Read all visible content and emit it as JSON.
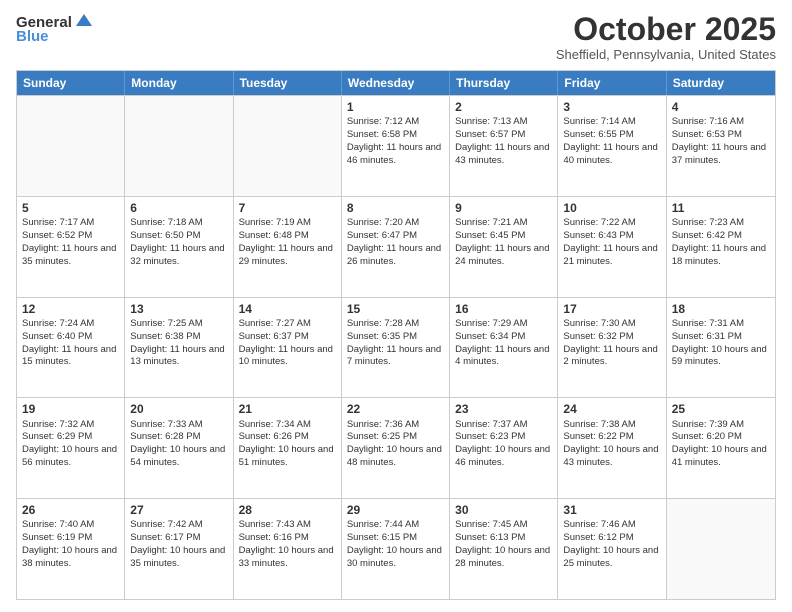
{
  "logo": {
    "general": "General",
    "blue": "Blue"
  },
  "header": {
    "month": "October 2025",
    "location": "Sheffield, Pennsylvania, United States"
  },
  "days": [
    "Sunday",
    "Monday",
    "Tuesday",
    "Wednesday",
    "Thursday",
    "Friday",
    "Saturday"
  ],
  "weeks": [
    [
      {
        "day": "",
        "info": ""
      },
      {
        "day": "",
        "info": ""
      },
      {
        "day": "",
        "info": ""
      },
      {
        "day": "1",
        "info": "Sunrise: 7:12 AM\nSunset: 6:58 PM\nDaylight: 11 hours and 46 minutes."
      },
      {
        "day": "2",
        "info": "Sunrise: 7:13 AM\nSunset: 6:57 PM\nDaylight: 11 hours and 43 minutes."
      },
      {
        "day": "3",
        "info": "Sunrise: 7:14 AM\nSunset: 6:55 PM\nDaylight: 11 hours and 40 minutes."
      },
      {
        "day": "4",
        "info": "Sunrise: 7:16 AM\nSunset: 6:53 PM\nDaylight: 11 hours and 37 minutes."
      }
    ],
    [
      {
        "day": "5",
        "info": "Sunrise: 7:17 AM\nSunset: 6:52 PM\nDaylight: 11 hours and 35 minutes."
      },
      {
        "day": "6",
        "info": "Sunrise: 7:18 AM\nSunset: 6:50 PM\nDaylight: 11 hours and 32 minutes."
      },
      {
        "day": "7",
        "info": "Sunrise: 7:19 AM\nSunset: 6:48 PM\nDaylight: 11 hours and 29 minutes."
      },
      {
        "day": "8",
        "info": "Sunrise: 7:20 AM\nSunset: 6:47 PM\nDaylight: 11 hours and 26 minutes."
      },
      {
        "day": "9",
        "info": "Sunrise: 7:21 AM\nSunset: 6:45 PM\nDaylight: 11 hours and 24 minutes."
      },
      {
        "day": "10",
        "info": "Sunrise: 7:22 AM\nSunset: 6:43 PM\nDaylight: 11 hours and 21 minutes."
      },
      {
        "day": "11",
        "info": "Sunrise: 7:23 AM\nSunset: 6:42 PM\nDaylight: 11 hours and 18 minutes."
      }
    ],
    [
      {
        "day": "12",
        "info": "Sunrise: 7:24 AM\nSunset: 6:40 PM\nDaylight: 11 hours and 15 minutes."
      },
      {
        "day": "13",
        "info": "Sunrise: 7:25 AM\nSunset: 6:38 PM\nDaylight: 11 hours and 13 minutes."
      },
      {
        "day": "14",
        "info": "Sunrise: 7:27 AM\nSunset: 6:37 PM\nDaylight: 11 hours and 10 minutes."
      },
      {
        "day": "15",
        "info": "Sunrise: 7:28 AM\nSunset: 6:35 PM\nDaylight: 11 hours and 7 minutes."
      },
      {
        "day": "16",
        "info": "Sunrise: 7:29 AM\nSunset: 6:34 PM\nDaylight: 11 hours and 4 minutes."
      },
      {
        "day": "17",
        "info": "Sunrise: 7:30 AM\nSunset: 6:32 PM\nDaylight: 11 hours and 2 minutes."
      },
      {
        "day": "18",
        "info": "Sunrise: 7:31 AM\nSunset: 6:31 PM\nDaylight: 10 hours and 59 minutes."
      }
    ],
    [
      {
        "day": "19",
        "info": "Sunrise: 7:32 AM\nSunset: 6:29 PM\nDaylight: 10 hours and 56 minutes."
      },
      {
        "day": "20",
        "info": "Sunrise: 7:33 AM\nSunset: 6:28 PM\nDaylight: 10 hours and 54 minutes."
      },
      {
        "day": "21",
        "info": "Sunrise: 7:34 AM\nSunset: 6:26 PM\nDaylight: 10 hours and 51 minutes."
      },
      {
        "day": "22",
        "info": "Sunrise: 7:36 AM\nSunset: 6:25 PM\nDaylight: 10 hours and 48 minutes."
      },
      {
        "day": "23",
        "info": "Sunrise: 7:37 AM\nSunset: 6:23 PM\nDaylight: 10 hours and 46 minutes."
      },
      {
        "day": "24",
        "info": "Sunrise: 7:38 AM\nSunset: 6:22 PM\nDaylight: 10 hours and 43 minutes."
      },
      {
        "day": "25",
        "info": "Sunrise: 7:39 AM\nSunset: 6:20 PM\nDaylight: 10 hours and 41 minutes."
      }
    ],
    [
      {
        "day": "26",
        "info": "Sunrise: 7:40 AM\nSunset: 6:19 PM\nDaylight: 10 hours and 38 minutes."
      },
      {
        "day": "27",
        "info": "Sunrise: 7:42 AM\nSunset: 6:17 PM\nDaylight: 10 hours and 35 minutes."
      },
      {
        "day": "28",
        "info": "Sunrise: 7:43 AM\nSunset: 6:16 PM\nDaylight: 10 hours and 33 minutes."
      },
      {
        "day": "29",
        "info": "Sunrise: 7:44 AM\nSunset: 6:15 PM\nDaylight: 10 hours and 30 minutes."
      },
      {
        "day": "30",
        "info": "Sunrise: 7:45 AM\nSunset: 6:13 PM\nDaylight: 10 hours and 28 minutes."
      },
      {
        "day": "31",
        "info": "Sunrise: 7:46 AM\nSunset: 6:12 PM\nDaylight: 10 hours and 25 minutes."
      },
      {
        "day": "",
        "info": ""
      }
    ]
  ]
}
